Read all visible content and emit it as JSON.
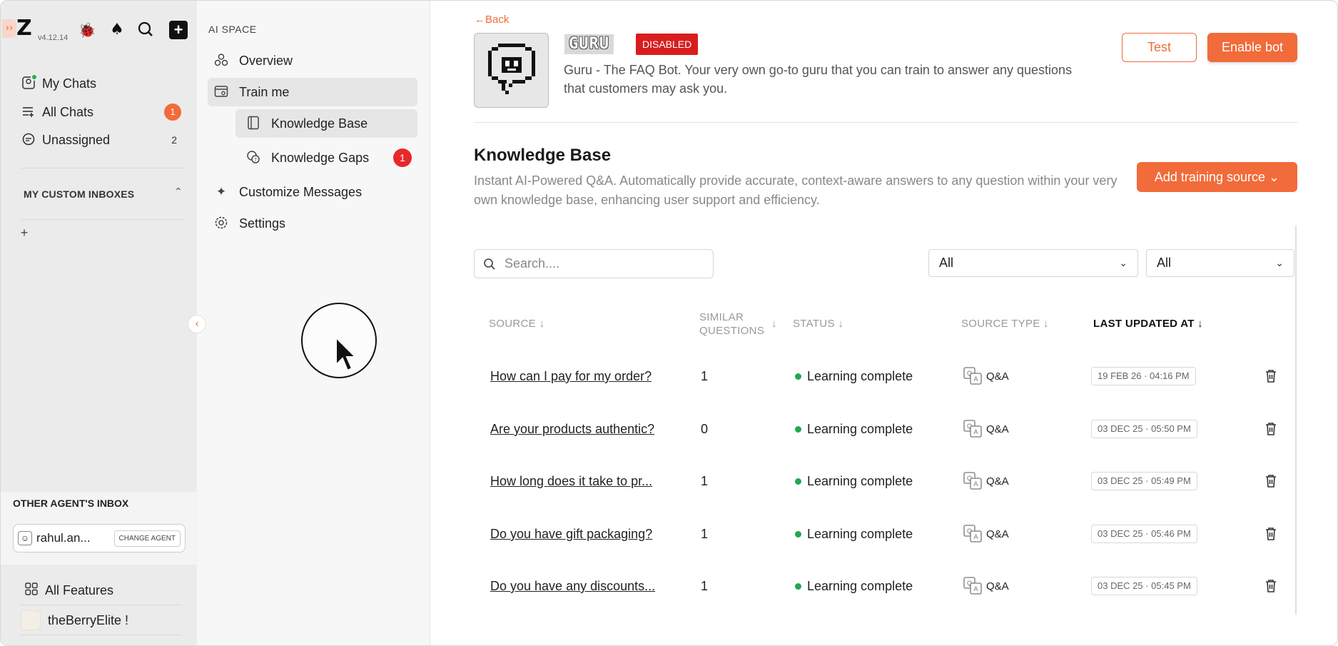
{
  "rail": {
    "version": "v4.12.14",
    "nav": [
      {
        "label": "My Chats",
        "count": "",
        "icon": "my-chats-icon"
      },
      {
        "label": "All Chats",
        "count": "1",
        "icon": "all-chats-icon"
      },
      {
        "label": "Unassigned",
        "count": "2",
        "icon": "unassigned-icon"
      }
    ],
    "custom_inboxes_title": "MY CUSTOM INBOXES",
    "other_inbox_title": "OTHER AGENT'S INBOX",
    "agent_name": "rahul.an...",
    "change_agent": "CHANGE AGENT",
    "all_features": "All Features",
    "store_name": "theBerryElite !"
  },
  "aispace": {
    "title": "AI SPACE",
    "items": {
      "overview": "Overview",
      "train": "Train me",
      "kb": "Knowledge Base",
      "gaps": "Knowledge Gaps",
      "gaps_count": "1",
      "customize": "Customize Messages",
      "settings": "Settings"
    }
  },
  "bot": {
    "back": "←Back",
    "name": "GURU",
    "status": "DISABLED",
    "description": "Guru - The FAQ Bot. Your very own go-to guru that you can train to answer any questions that customers may ask you.",
    "test_label": "Test",
    "enable_label": "Enable bot"
  },
  "kb": {
    "title": "Knowledge Base",
    "description": "Instant AI-Powered Q&A. Automatically provide accurate, context-aware answers to any question within your very own knowledge base, enhancing user support and efficiency.",
    "add_label": "Add training source ⌄",
    "search_placeholder": "Search....",
    "filter1": "All",
    "filter2": "All"
  },
  "table": {
    "headers": {
      "source": "SOURCE ↓",
      "similar1": "SIMILAR",
      "similar2": "QUESTIONS",
      "similar_arrow": "↓",
      "status": "STATUS ↓",
      "source_type": "SOURCE TYPE ↓",
      "updated": "LAST UPDATED AT ↓"
    },
    "rows": [
      {
        "source": "How can I pay for my order?",
        "similar": "1",
        "status": "Learning complete",
        "type": "Q&A",
        "updated": "19 FEB 26 · 04:16 PM"
      },
      {
        "source": "Are your products authentic?",
        "similar": "0",
        "status": "Learning complete",
        "type": "Q&A",
        "updated": "03 DEC 25 · 05:50 PM"
      },
      {
        "source": "How long does it take to pr...",
        "similar": "1",
        "status": "Learning complete",
        "type": "Q&A",
        "updated": "03 DEC 25 · 05:49 PM"
      },
      {
        "source": "Do you have gift packaging?",
        "similar": "1",
        "status": "Learning complete",
        "type": "Q&A",
        "updated": "03 DEC 25 · 05:46 PM"
      },
      {
        "source": "Do you have any discounts...",
        "similar": "1",
        "status": "Learning complete",
        "type": "Q&A",
        "updated": "03 DEC 25 · 05:45 PM"
      }
    ]
  },
  "colors": {
    "accent": "#f26b3a",
    "danger": "#d81d1d",
    "success": "#1fa84f"
  }
}
